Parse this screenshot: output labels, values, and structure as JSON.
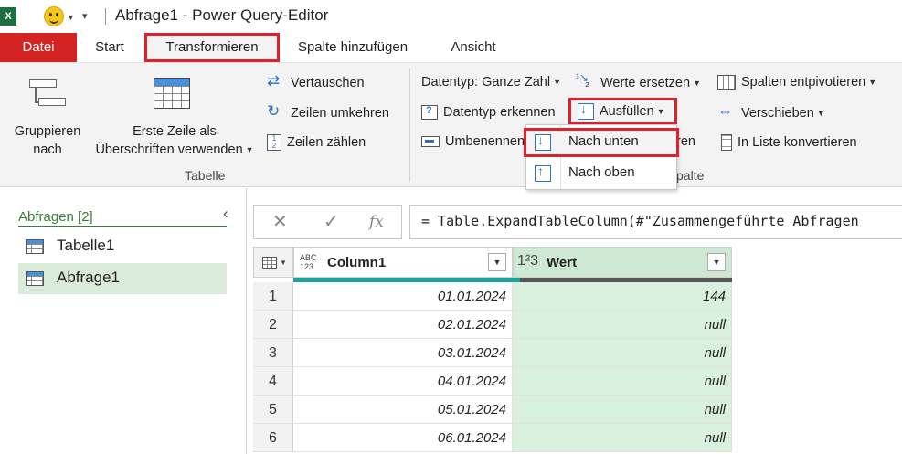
{
  "titlebar": {
    "app_title": "Abfrage1 - Power Query-Editor",
    "excel_badge": "X"
  },
  "tabs": [
    {
      "label": "Datei"
    },
    {
      "label": "Start"
    },
    {
      "label": "Transformieren"
    },
    {
      "label": "Spalte hinzufügen"
    },
    {
      "label": "Ansicht"
    }
  ],
  "ribbon": {
    "group_by": "Gruppieren nach",
    "group_by_l1": "Gruppieren",
    "group_by_l2": "nach",
    "first_row_l1": "Erste Zeile als",
    "first_row_l2": "Überschriften verwenden",
    "transpose": "Vertauschen",
    "reverse_rows": "Zeilen umkehren",
    "count_rows": "Zeilen zählen",
    "table_group": "Tabelle",
    "data_type": "Datentyp: Ganze Zahl",
    "detect_type": "Datentyp erkennen",
    "rename": "Umbenennen",
    "replace_values": "Werte ersetzen",
    "fill": "Ausfüllen",
    "pivot_partial": "ren",
    "any_column_partial": "palte",
    "unpivot": "Spalten entpivotieren",
    "move": "Verschieben",
    "to_list": "In Liste konvertieren",
    "fill_menu": [
      "Nach unten",
      "Nach oben"
    ]
  },
  "queries": {
    "header": "Abfragen [2]",
    "items": [
      "Tabelle1",
      "Abfrage1"
    ],
    "selected": "Abfrage1"
  },
  "formula_bar": {
    "cancel": "✕",
    "confirm": "✓",
    "fx": "fx",
    "formula": "= Table.ExpandTableColumn(#\"Zusammengeführte Abfragen"
  },
  "grid": {
    "columns": [
      {
        "name": "Column1",
        "type": "ABC 123"
      },
      {
        "name": "Wert",
        "type": "1²3"
      }
    ],
    "rows": [
      {
        "n": "1",
        "c1": "01.01.2024",
        "c2": "144"
      },
      {
        "n": "2",
        "c1": "02.01.2024",
        "c2": "null"
      },
      {
        "n": "3",
        "c1": "03.01.2024",
        "c2": "null"
      },
      {
        "n": "4",
        "c1": "04.01.2024",
        "c2": "null"
      },
      {
        "n": "5",
        "c1": "05.01.2024",
        "c2": "null"
      },
      {
        "n": "6",
        "c1": "06.01.2024",
        "c2": "null"
      }
    ]
  },
  "colors": {
    "file_tab": "#d42323",
    "highlight": "#e0202a",
    "selected_query": "#d9ecdc",
    "value_column": "#cde9d3",
    "accent_blue": "#2e72c2"
  }
}
